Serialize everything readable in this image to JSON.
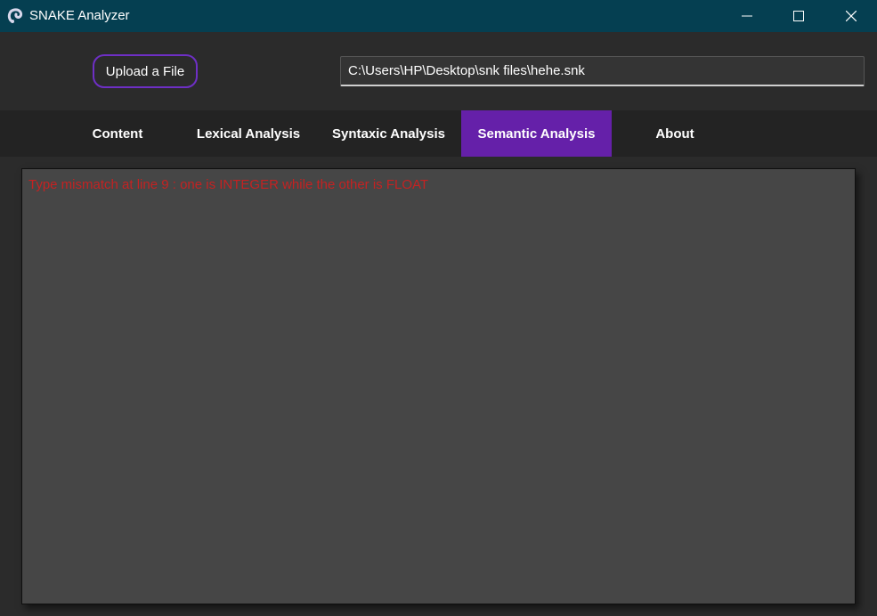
{
  "window": {
    "title": "SNAKE Analyzer",
    "icon": "snake-logo-icon",
    "controls": [
      "minimize-icon",
      "maximize-icon",
      "close-icon"
    ]
  },
  "toolbar": {
    "upload_label": "Upload a File",
    "file_path": "C:\\Users\\HP\\Desktop\\snk files\\hehe.snk"
  },
  "tabs": [
    {
      "label": "Content",
      "active": false
    },
    {
      "label": "Lexical Analysis",
      "active": false
    },
    {
      "label": "Syntaxic Analysis",
      "active": false
    },
    {
      "label": "Semantic Analysis",
      "active": true
    },
    {
      "label": "About",
      "active": false
    }
  ],
  "output": {
    "message": "Type mismatch at line 9 : one is INTEGER while the other is FLOAT"
  },
  "colors": {
    "titlebar": "#053f51",
    "accent": "#6520a9",
    "error_text": "#c42222",
    "background": "#2b2b2b",
    "panel": "#464646"
  }
}
